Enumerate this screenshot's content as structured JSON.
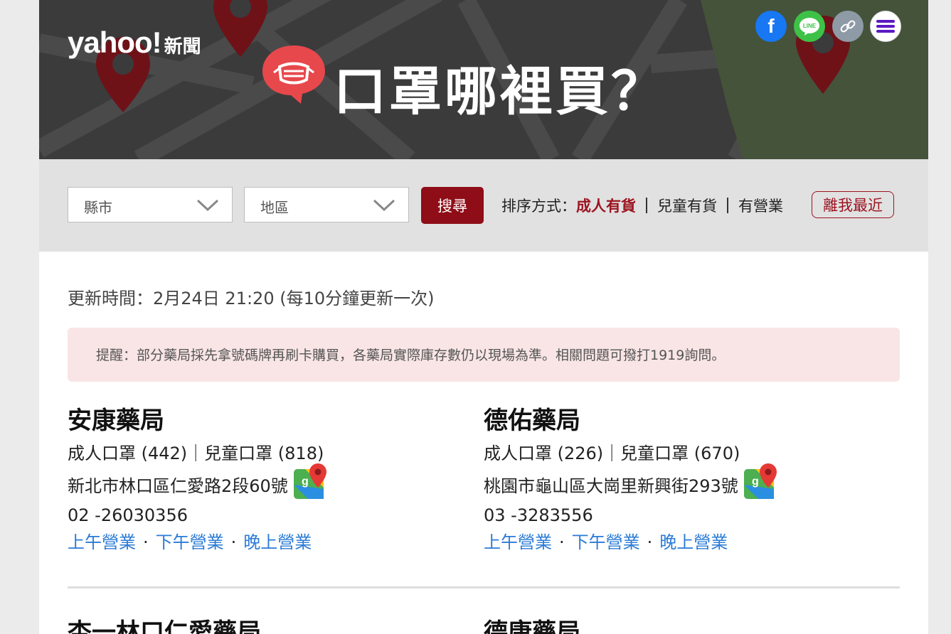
{
  "header": {
    "logo_brand": "yahoo!",
    "logo_sub": "新聞",
    "title": "口罩哪裡買？",
    "share": {
      "facebook_icon": "f",
      "line_icon": "LINE"
    }
  },
  "filters": {
    "county_placeholder": "縣市",
    "district_placeholder": "地區",
    "search_label": "搜尋",
    "sort_label": "排序方式：",
    "sort_options": [
      "成人有貨",
      "兒童有貨",
      "有營業"
    ],
    "nearest_label": "離我最近"
  },
  "main": {
    "updated_text": "更新時間：2月24日 21:20 (每10分鐘更新一次)",
    "notice_text": "提醒：部分藥局採先拿號碼牌再刷卡購買，各藥局實際庫存數仍以現場為準。相關問題可撥打1919詢問。",
    "pharmacies": [
      {
        "name": "安康藥局",
        "stock": "成人口罩 (442)｜兒童口罩 (818)",
        "address": "新北市林口區仁愛路2段60號",
        "phone": "02 -26030356",
        "hours": [
          "上午營業",
          "下午營業",
          "晚上營業"
        ]
      },
      {
        "name": "德佑藥局",
        "stock": "成人口罩 (226)｜兒童口罩 (670)",
        "address": "桃園市龜山區大崗里新興街293號",
        "phone": "03 -3283556",
        "hours": [
          "上午營業",
          "下午營業",
          "晚上營業"
        ]
      }
    ],
    "next_names": [
      "杏一林口仁愛藥局",
      "德康藥局"
    ],
    "hours_separator": "·"
  },
  "colors": {
    "accent": "#8e0d17",
    "link": "#2b7bd6",
    "banner_bg": "#3b3b3b",
    "notice_bg": "#f9e5e5"
  }
}
